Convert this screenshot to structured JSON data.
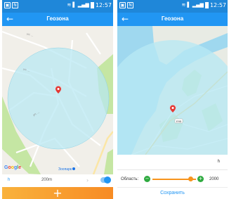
{
  "left_screen": {
    "status_bar": {
      "time": "12:57",
      "notification_icons": [
        "image-icon",
        "n-icon"
      ]
    },
    "app_bar": {
      "title": "Геозона"
    },
    "map": {
      "provider": "Google",
      "street_labels": [
        "ул. ...",
        "ул. ...",
        "ул. ..."
      ],
      "poi_label": "Зоопарк"
    },
    "controls": {
      "label": "h",
      "radius": "200m",
      "toggle_on": true
    },
    "add_bar": {
      "icon": "plus-icon"
    }
  },
  "right_screen": {
    "status_bar": {
      "time": "12:57",
      "notification_icons": [
        "image-icon",
        "n-icon"
      ]
    },
    "app_bar": {
      "title": "Геозона"
    },
    "map": {
      "road_shield": "E95"
    },
    "input_value": "h",
    "area": {
      "label": "Область:",
      "value": "2000",
      "slider_fraction": 0.85
    },
    "save_label": "Сохранить"
  },
  "colors": {
    "status_bar": "#1f87d9",
    "app_bar": "#2196f3",
    "geofence_fill": "#b7e8f3",
    "accent_orange": "#f7941d",
    "green_button": "#2eaa3f"
  }
}
